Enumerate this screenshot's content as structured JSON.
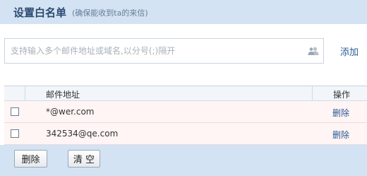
{
  "header": {
    "title": "设置白名单",
    "subtitle": "(确保能收到ta的来信)"
  },
  "input": {
    "placeholder": "支持输入多个邮件地址或域名,以分号(;)隔开",
    "value": ""
  },
  "add_label": "添加",
  "table": {
    "columns": [
      "邮件地址",
      "操作"
    ],
    "rows": [
      {
        "email": "*@wer.com",
        "action": "删除"
      },
      {
        "email": "342534@qe.com",
        "action": "删除"
      }
    ]
  },
  "footer": {
    "delete_label": "删除",
    "clear_label": "清 空"
  },
  "icons": {
    "contacts": "contacts-icon"
  }
}
